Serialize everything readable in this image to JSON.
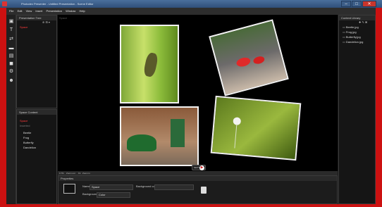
{
  "window": {
    "title": "Photodex Presenter - Untitled Presentation - Scene Editor"
  },
  "menu": {
    "items": [
      "File",
      "Edit",
      "View",
      "Insert",
      "Presentation",
      "Window",
      "Help"
    ]
  },
  "presentation_tree": {
    "title": "Presentation Tree",
    "items": [
      "Space"
    ]
  },
  "space_content": {
    "title": "Space Content",
    "items": [
      "Space",
      "Inserted",
      "Beetle",
      "Frog",
      "Butterfly",
      "Dandelion"
    ]
  },
  "canvas": {
    "tab_label": "Space",
    "nav_label": "NEXT"
  },
  "status": {
    "zoom": "0.7fit",
    "segments": [
      "0.7fit",
      "Zoom out",
      "Fit",
      "Zoom in"
    ]
  },
  "properties": {
    "title": "Properties",
    "name_label": "Name",
    "name_value": "Space",
    "bg_color_label": "Background color",
    "background_label": "Background",
    "background_value": "Color"
  },
  "content_library": {
    "title": "Content Library",
    "items": [
      "Beetle.jpg",
      "Frog.jpg",
      "Butterfly.jpg",
      "Dandelion.jpg"
    ]
  }
}
